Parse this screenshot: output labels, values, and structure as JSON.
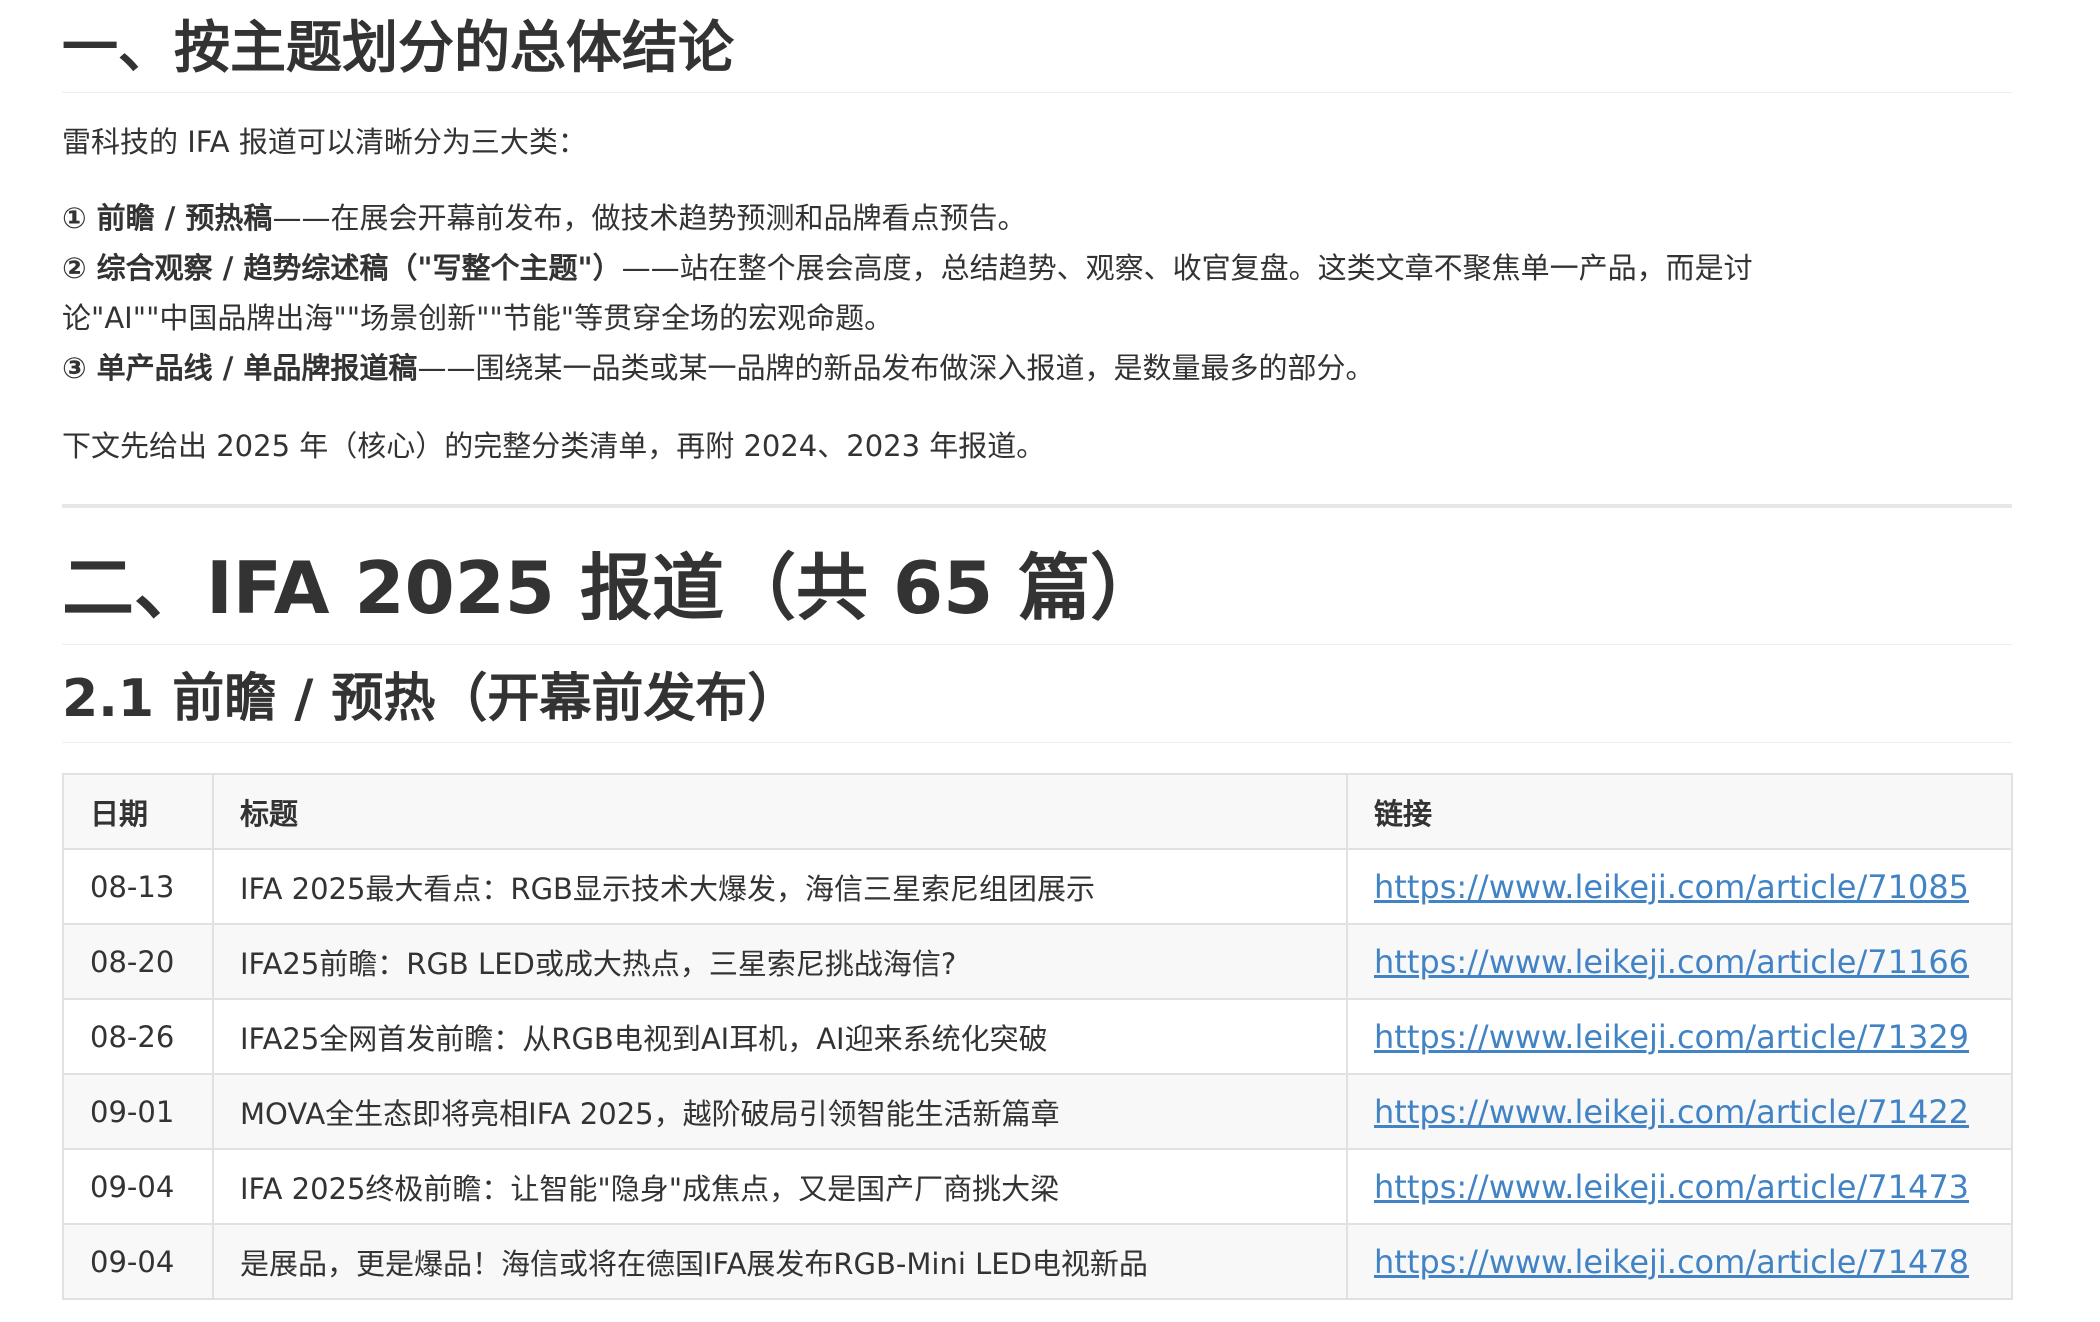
{
  "section1": {
    "heading": "一、按主题划分的总体结论",
    "intro": "雷科技的 IFA 报道可以清晰分为三大类：",
    "points": [
      {
        "label": "① 前瞻 / 预热稿",
        "text": "——在展会开幕前发布，做技术趋势预测和品牌看点预告。"
      },
      {
        "label": "② 综合观察 / 趋势综述稿（\"写整个主题\"）",
        "text": "——站在整个展会高度，总结趋势、观察、收官复盘。这类文章不聚焦单一产品，而是讨",
        "text_cont": "论\"AI\"\"中国品牌出海\"\"场景创新\"\"节能\"等贯穿全场的宏观命题。"
      },
      {
        "label": "③ 单产品线 / 单品牌报道稿",
        "text": "——围绕某一品类或某一品牌的新品发布做深入报道，是数量最多的部分。"
      }
    ],
    "outro": "下文先给出 2025 年（核心）的完整分类清单，再附 2024、2023 年报道。"
  },
  "section2": {
    "heading": "二、IFA 2025 报道（共 65 篇）",
    "subheading": "2.1 前瞻 / 预热（开幕前发布）",
    "table": {
      "headers": [
        "日期",
        "标题",
        "链接"
      ],
      "rows": [
        [
          "08-13",
          "IFA 2025最大看点：RGB显示技术大爆发，海信三星索尼组团展示",
          "https://www.leikeji.com/article/71085"
        ],
        [
          "08-20",
          "IFA25前瞻：RGB LED或成大热点，三星索尼挑战海信?",
          "https://www.leikeji.com/article/71166"
        ],
        [
          "08-26",
          "IFA25全网首发前瞻：从RGB电视到AI耳机，AI迎来系统化突破",
          "https://www.leikeji.com/article/71329"
        ],
        [
          "09-01",
          "MOVA全生态即将亮相IFA 2025，越阶破局引领智能生活新篇章",
          "https://www.leikeji.com/article/71422"
        ],
        [
          "09-04",
          "IFA 2025终极前瞻：让智能\"隐身\"成焦点，又是国产厂商挑大梁",
          "https://www.leikeji.com/article/71473"
        ],
        [
          "09-04",
          "是展品，更是爆品！海信或将在德国IFA展发布RGB-Mini LED电视新品",
          "https://www.leikeji.com/article/71478"
        ]
      ]
    }
  },
  "colors": {
    "text": "#333333",
    "link": "#4183c4",
    "table_border": "#dfe2e5",
    "header_bg": "#f8f8f8"
  }
}
